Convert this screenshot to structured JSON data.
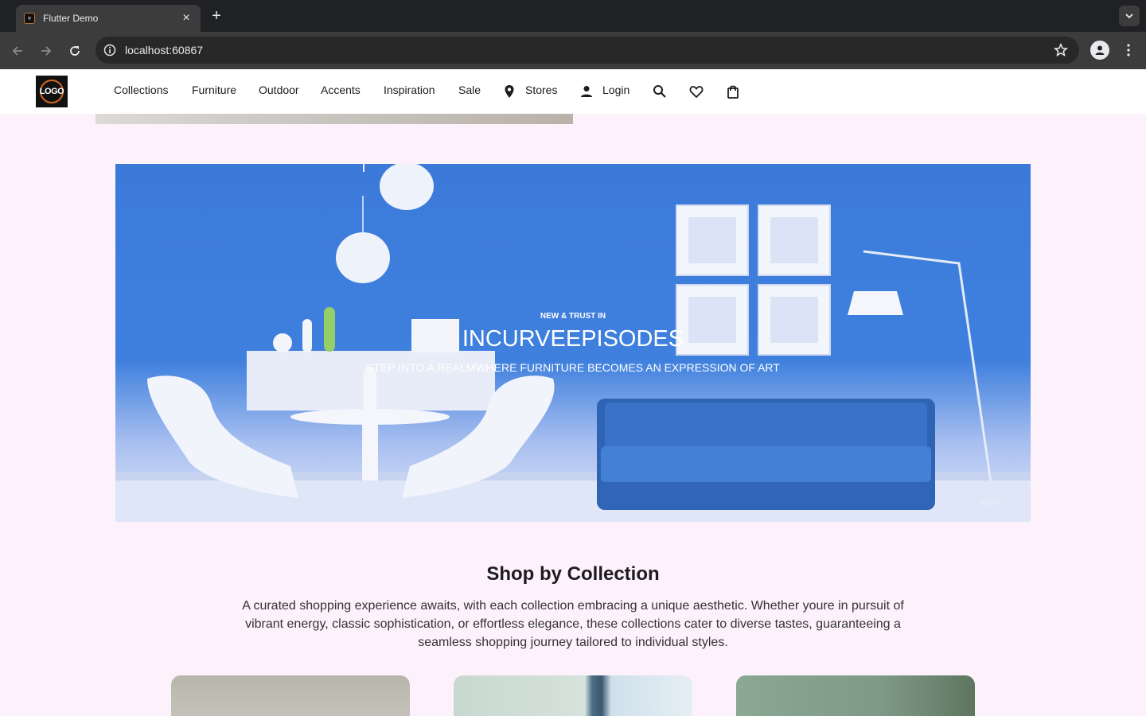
{
  "browser": {
    "tab_title": "Flutter Demo",
    "new_tab_label": "+",
    "url": "localhost:60867"
  },
  "header": {
    "logo_text": "LOGO",
    "nav": [
      "Collections",
      "Furniture",
      "Outdoor",
      "Accents",
      "Inspiration",
      "Sale"
    ],
    "stores_label": "Stores",
    "login_label": "Login",
    "icons": [
      "location-pin-icon",
      "person-icon",
      "search-icon",
      "heart-icon",
      "shopping-bag-icon"
    ]
  },
  "hero": {
    "kicker": "NEW & TRUST IN",
    "title": "INCURVEEPISODES",
    "subtitle": "STEP INTO A REALMWHERE FURNITURE BECOMES AN EXPRESSION OF ART"
  },
  "collections": {
    "title": "Shop by Collection",
    "description": "A curated shopping experience awaits, with each collection embracing a unique aesthetic. Whether youre in pursuit of vibrant energy, classic sophistication, or effortless elegance, these collections cater to diverse tastes, guaranteeing a seamless shopping journey tailored to individual styles."
  },
  "colors": {
    "page_bg": "#fdf2fb",
    "hero_blue": "#3f80de",
    "chrome_dark": "#202124"
  }
}
